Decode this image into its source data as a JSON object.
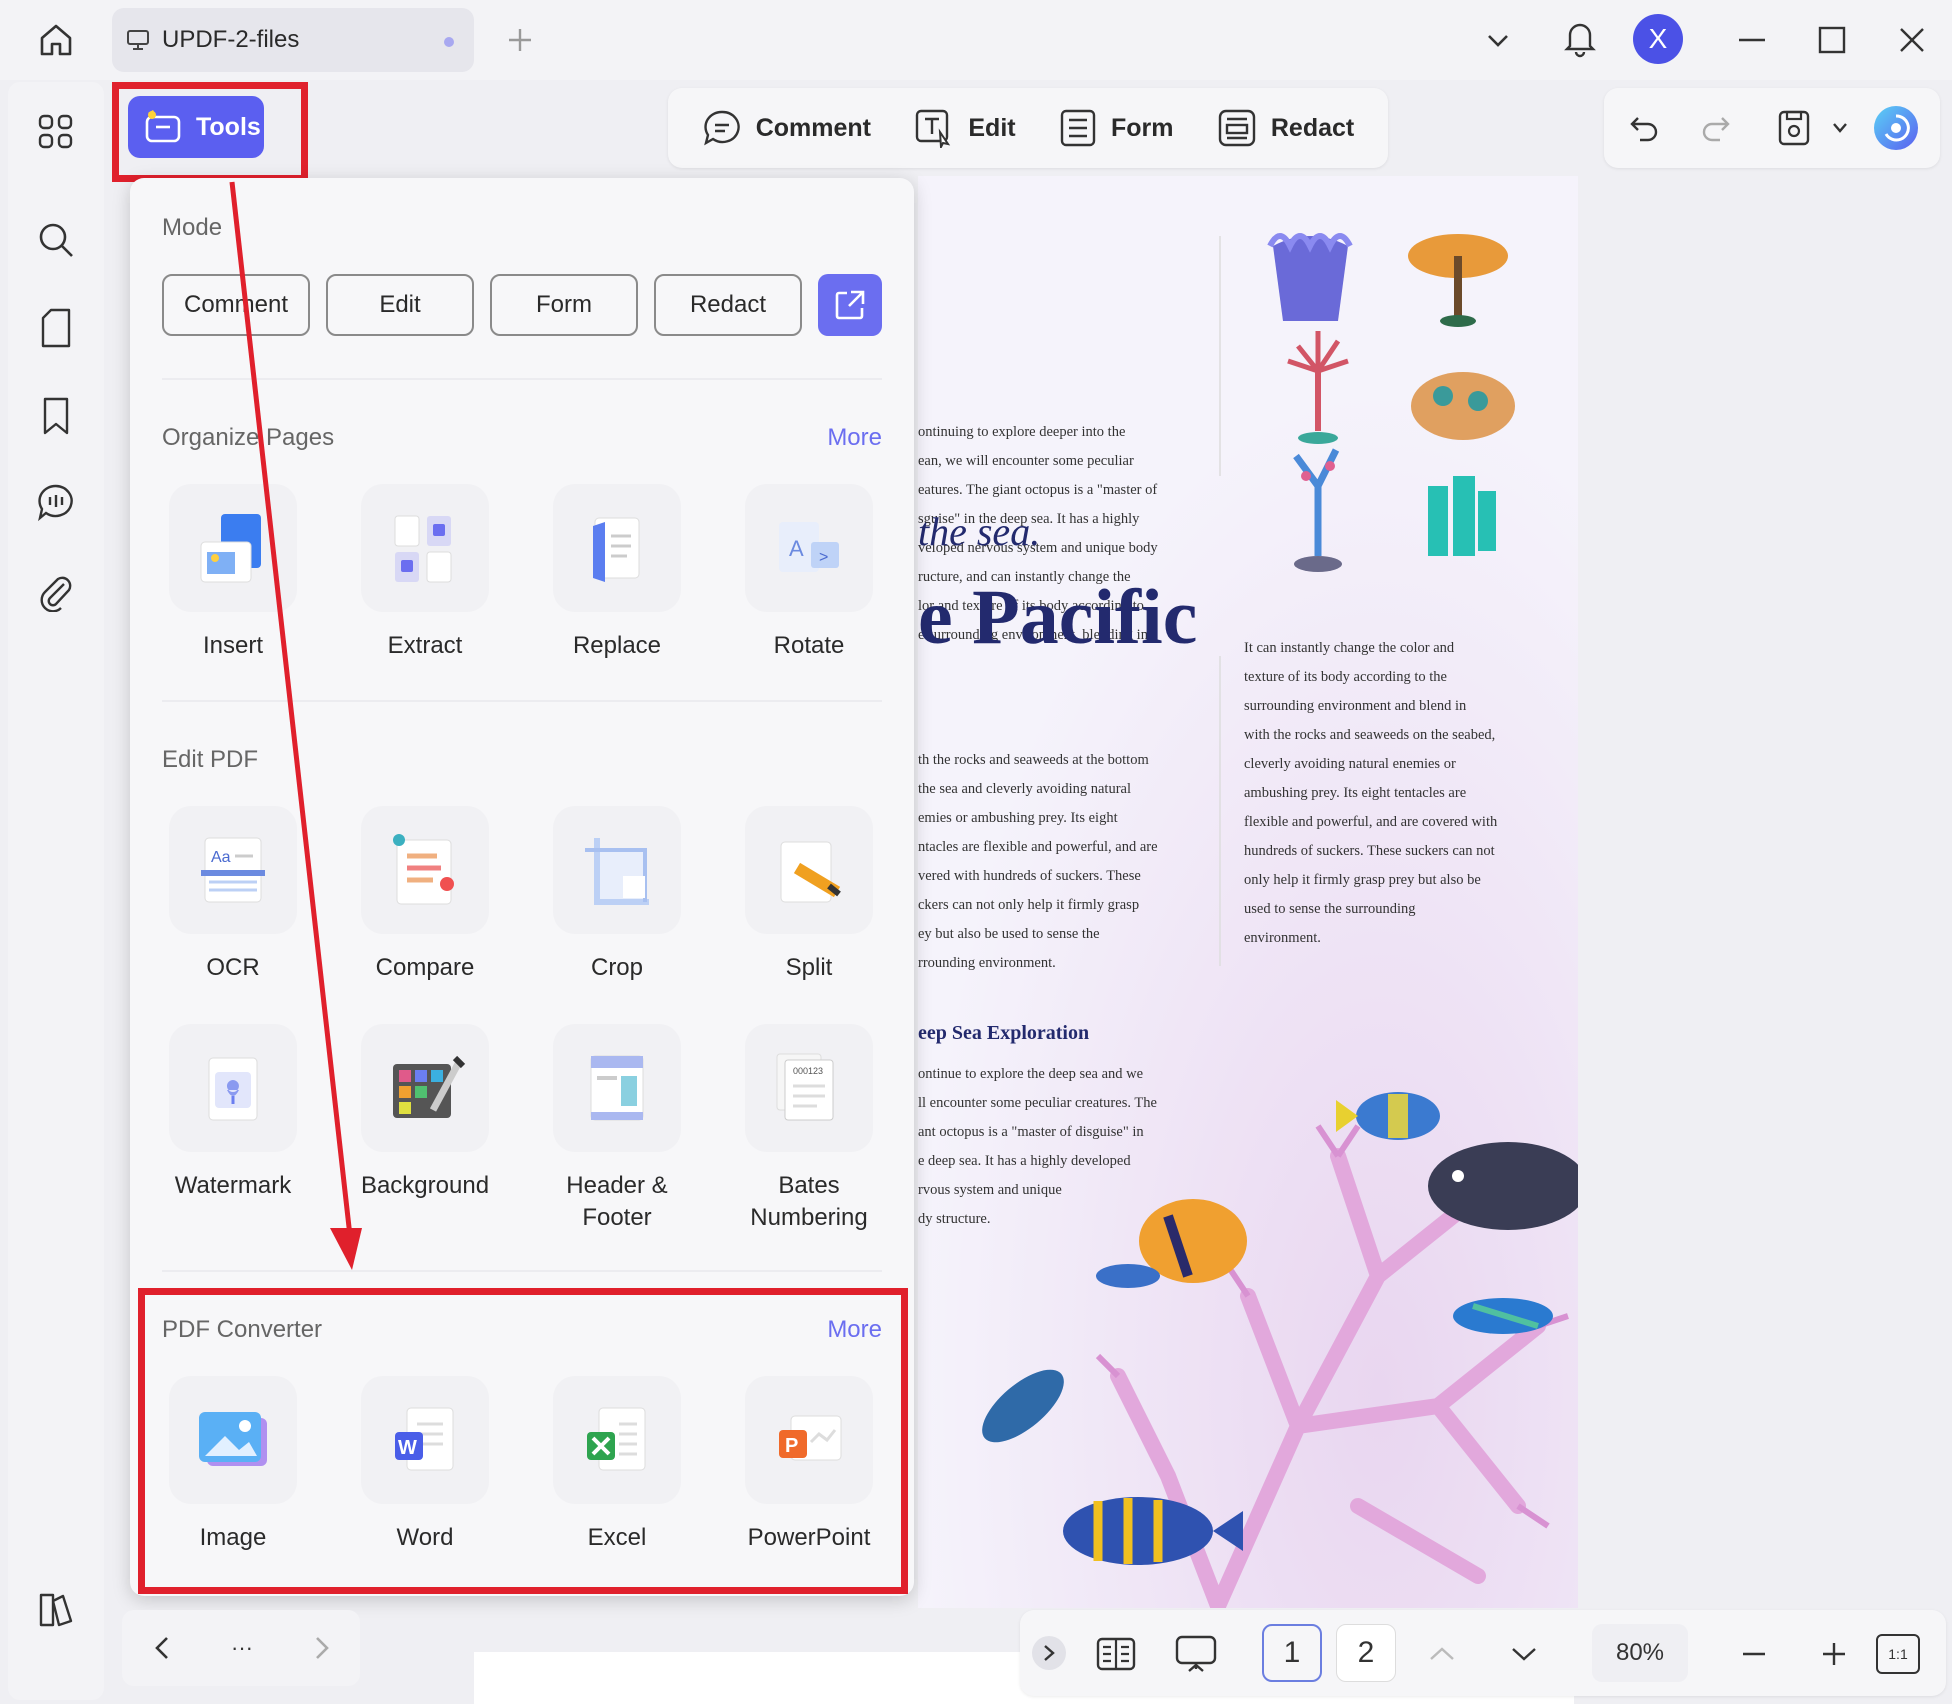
{
  "titlebar": {
    "tab_name": "UPDF-2-files",
    "avatar_letter": "X"
  },
  "tools_button": {
    "label": "Tools"
  },
  "mode_toolbar": {
    "tabs": [
      {
        "label": "Comment"
      },
      {
        "label": "Edit"
      },
      {
        "label": "Form"
      },
      {
        "label": "Redact"
      }
    ]
  },
  "tools_panel": {
    "mode": {
      "title": "Mode",
      "buttons": [
        "Comment",
        "Edit",
        "Form",
        "Redact"
      ]
    },
    "organize": {
      "title": "Organize Pages",
      "more": "More",
      "tools": [
        "Insert",
        "Extract",
        "Replace",
        "Rotate"
      ]
    },
    "edit_pdf": {
      "title": "Edit PDF",
      "tools": [
        "OCR",
        "Compare",
        "Crop",
        "Split",
        "Watermark",
        "Background",
        "Header & Footer",
        "Bates Numbering"
      ]
    },
    "converter": {
      "title": "PDF Converter",
      "more": "More",
      "tools": [
        "Image",
        "Word",
        "Excel",
        "PowerPoint"
      ]
    }
  },
  "document": {
    "col1_para1": [
      "ontinuing to explore deeper into the",
      "ean, we will encounter some peculiar",
      "eatures. The giant octopus is a \"master of",
      "sguise\" in the deep sea. It has a highly",
      "veloped nervous system and unique body",
      "ructure, and can instantly change the",
      "lor and texture of its body according to",
      "e surrounding environment, blending in"
    ],
    "heading_italic": "the sea.",
    "heading_large": "e Pacific",
    "col1_para2": [
      "th the rocks and seaweeds at the bottom",
      " the sea and cleverly avoiding natural",
      "emies or ambushing prey. Its eight",
      "ntacles are flexible and powerful, and are",
      "vered with hundreds of suckers. These",
      "ckers can not only help it firmly grasp",
      "ey but also be used to sense the",
      "rrounding environment."
    ],
    "subheading": "eep Sea Exploration",
    "col1_para3": [
      "ontinue to explore the deep sea and we",
      "ll encounter some peculiar creatures. The",
      "ant octopus is a \"master of disguise\" in",
      "e deep sea. It has a highly developed",
      "rvous system and unique",
      "dy structure."
    ],
    "col2_para": [
      "It can instantly change the color and",
      "texture of its body according to the",
      "surrounding environment and blend in",
      "with the rocks and seaweeds on the seabed,",
      "cleverly avoiding natural enemies or",
      "ambushing prey. Its eight tentacles are",
      "flexible and powerful, and are covered with",
      "hundreds of suckers. These suckers can not",
      "only help it firmly grasp prey but also be",
      "used to sense the surrounding",
      "environment."
    ]
  },
  "nav_bar": {
    "more": "···"
  },
  "bottom_bar": {
    "pages": [
      "1",
      "2"
    ],
    "current_page": "1",
    "zoom": "80%",
    "fit_label": "1:1"
  },
  "colors": {
    "accent": "#5b5ff0",
    "highlight": "#e0202c",
    "heading": "#232a6e"
  }
}
